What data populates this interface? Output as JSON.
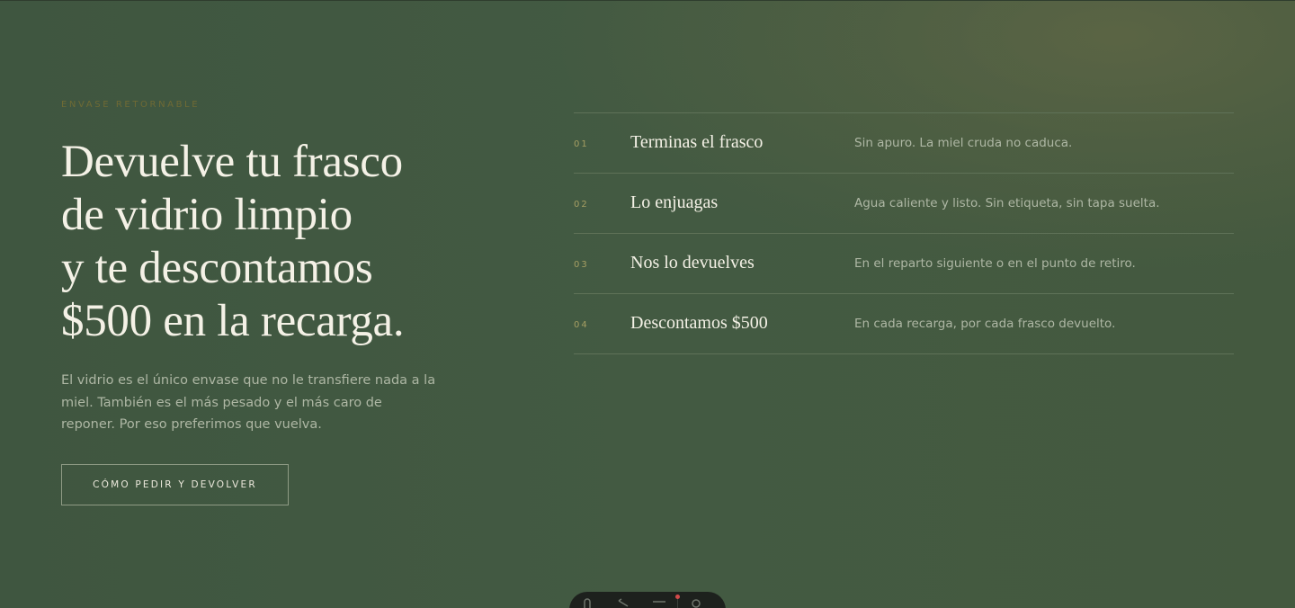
{
  "hero": {
    "eyebrow": "ENVASE RETORNABLE",
    "headline": [
      "Devuelve tu frasco",
      "de vidrio limpio",
      "y te descontamos",
      "$500 en la recarga."
    ],
    "lead": "El vidrio es el único envase que no le transfiere nada a la miel. También es el más pesado y el más caro de reponer. Por eso preferimos que vuelva.",
    "cta_label": "CÓMO PEDIR Y DEVOLVER"
  },
  "steps": [
    {
      "num": "01",
      "title": "Terminas el frasco",
      "desc": "Sin apuro. La miel cruda no caduca."
    },
    {
      "num": "02",
      "title": "Lo enjuagas",
      "desc": "Agua caliente y listo. Sin etiqueta, sin tapa suelta."
    },
    {
      "num": "03",
      "title": "Nos lo devuelves",
      "desc": "En el reparto siguiente o en el punto de retiro."
    },
    {
      "num": "04",
      "title": "Descontamos $500",
      "desc": "En cada recarga, por cada frasco devuelto."
    }
  ],
  "dock": {
    "icons": [
      "user-icon",
      "pen-icon",
      "menu-icon",
      "gear-icon"
    ],
    "notification_color": "#d24a4a"
  },
  "colors": {
    "background": "#425740",
    "accent": "#a69f63",
    "text": "#f4f1e6"
  }
}
